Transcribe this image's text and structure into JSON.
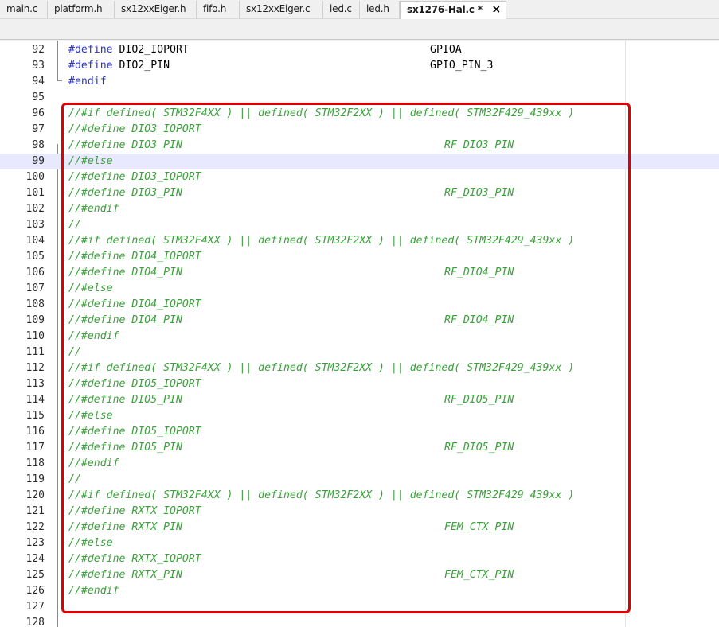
{
  "tabs": [
    {
      "label": "main.c"
    },
    {
      "label": "platform.h"
    },
    {
      "label": "sx12xxEiger.h"
    },
    {
      "label": "fifo.h"
    },
    {
      "label": "sx12xxEiger.c"
    },
    {
      "label": "led.c"
    },
    {
      "label": "led.h"
    },
    {
      "label": "sx1276-Hal.c *",
      "active": true
    }
  ],
  "close_icon": "×",
  "editor": {
    "current_line": 99,
    "highlight_color": "#e00000",
    "lines": [
      {
        "num": "92",
        "kw": "#define",
        "text": " DIO2_IOPORT",
        "rhs": "GPIOA"
      },
      {
        "num": "93",
        "kw": "#define",
        "text": " DIO2_PIN",
        "rhs": "GPIO_PIN_3"
      },
      {
        "num": "94",
        "kw": "#endif",
        "text": ""
      },
      {
        "num": "95",
        "text": ""
      },
      {
        "num": "96",
        "comment": "//#if defined( STM32F4XX ) || defined( STM32F2XX ) || defined( STM32F429_439xx )"
      },
      {
        "num": "97",
        "comment": "//#define DIO3_IOPORT"
      },
      {
        "num": "98",
        "comment": "//#define DIO3_PIN",
        "rhs_comment": "RF_DIO3_PIN"
      },
      {
        "num": "99",
        "comment": "//#else"
      },
      {
        "num": "100",
        "comment": "//#define DIO3_IOPORT"
      },
      {
        "num": "101",
        "comment": "//#define DIO3_PIN",
        "rhs_comment": "RF_DIO3_PIN"
      },
      {
        "num": "102",
        "comment": "//#endif"
      },
      {
        "num": "103",
        "comment": "//"
      },
      {
        "num": "104",
        "comment": "//#if defined( STM32F4XX ) || defined( STM32F2XX ) || defined( STM32F429_439xx )"
      },
      {
        "num": "105",
        "comment": "//#define DIO4_IOPORT"
      },
      {
        "num": "106",
        "comment": "//#define DIO4_PIN",
        "rhs_comment": "RF_DIO4_PIN"
      },
      {
        "num": "107",
        "comment": "//#else"
      },
      {
        "num": "108",
        "comment": "//#define DIO4_IOPORT"
      },
      {
        "num": "109",
        "comment": "//#define DIO4_PIN",
        "rhs_comment": "RF_DIO4_PIN"
      },
      {
        "num": "110",
        "comment": "//#endif"
      },
      {
        "num": "111",
        "comment": "//"
      },
      {
        "num": "112",
        "comment": "//#if defined( STM32F4XX ) || defined( STM32F2XX ) || defined( STM32F429_439xx )"
      },
      {
        "num": "113",
        "comment": "//#define DIO5_IOPORT"
      },
      {
        "num": "114",
        "comment": "//#define DIO5_PIN",
        "rhs_comment": "RF_DIO5_PIN"
      },
      {
        "num": "115",
        "comment": "//#else"
      },
      {
        "num": "116",
        "comment": "//#define DIO5_IOPORT"
      },
      {
        "num": "117",
        "comment": "//#define DIO5_PIN",
        "rhs_comment": "RF_DIO5_PIN"
      },
      {
        "num": "118",
        "comment": "//#endif"
      },
      {
        "num": "119",
        "comment": "//"
      },
      {
        "num": "120",
        "comment": "//#if defined( STM32F4XX ) || defined( STM32F2XX ) || defined( STM32F429_439xx )"
      },
      {
        "num": "121",
        "comment": "//#define RXTX_IOPORT"
      },
      {
        "num": "122",
        "comment": "//#define RXTX_PIN",
        "rhs_comment": "FEM_CTX_PIN"
      },
      {
        "num": "123",
        "comment": "//#else"
      },
      {
        "num": "124",
        "comment": "//#define RXTX_IOPORT"
      },
      {
        "num": "125",
        "comment": "//#define RXTX_PIN",
        "rhs_comment": "FEM_CTX_PIN"
      },
      {
        "num": "126",
        "comment": "//#endif"
      },
      {
        "num": "127",
        "text": ""
      },
      {
        "num": "128",
        "text": ""
      }
    ]
  }
}
